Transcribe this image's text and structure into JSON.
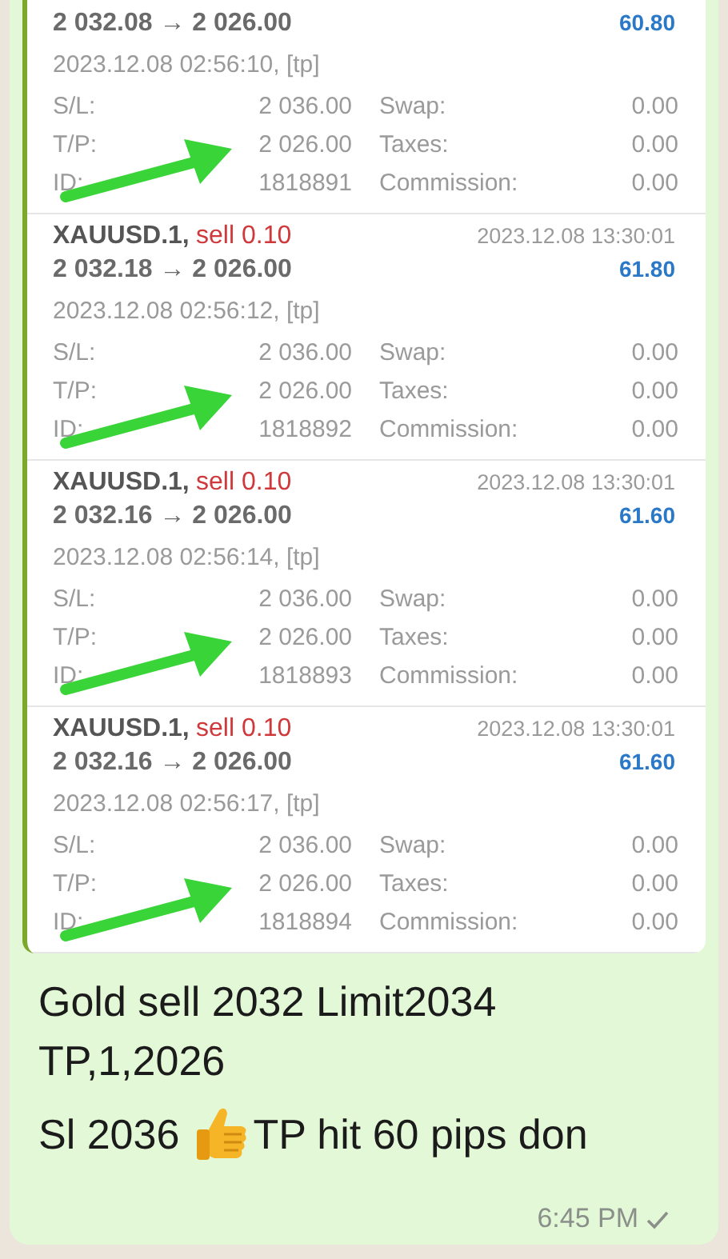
{
  "trades": [
    {
      "prices": "2 032.08 → 2 026.00",
      "profit": "60.80",
      "open_info": "2023.12.08 02:56:10, [tp]",
      "details": [
        {
          "label_1": "S/L:",
          "value_1": "2 036.00",
          "label_2": "Swap:",
          "value_2": "0.00"
        },
        {
          "label_1": "T/P:",
          "value_1": "2 026.00",
          "label_2": "Taxes:",
          "value_2": "0.00"
        },
        {
          "label_1": "ID:",
          "value_1": "1818891",
          "label_2": "Commission:",
          "value_2": "0.00"
        }
      ]
    },
    {
      "symbol": "XAUUSD.1,",
      "direction": "sell",
      "volume": "0.10",
      "close_time": "2023.12.08 13:30:01",
      "prices": "2 032.18 → 2 026.00",
      "profit": "61.80",
      "open_info": "2023.12.08 02:56:12, [tp]",
      "details": [
        {
          "label_1": "S/L:",
          "value_1": "2 036.00",
          "label_2": "Swap:",
          "value_2": "0.00"
        },
        {
          "label_1": "T/P:",
          "value_1": "2 026.00",
          "label_2": "Taxes:",
          "value_2": "0.00"
        },
        {
          "label_1": "ID:",
          "value_1": "1818892",
          "label_2": "Commission:",
          "value_2": "0.00"
        }
      ]
    },
    {
      "symbol": "XAUUSD.1,",
      "direction": "sell",
      "volume": "0.10",
      "close_time": "2023.12.08 13:30:01",
      "prices": "2 032.16 → 2 026.00",
      "profit": "61.60",
      "open_info": "2023.12.08 02:56:14, [tp]",
      "details": [
        {
          "label_1": "S/L:",
          "value_1": "2 036.00",
          "label_2": "Swap:",
          "value_2": "0.00"
        },
        {
          "label_1": "T/P:",
          "value_1": "2 026.00",
          "label_2": "Taxes:",
          "value_2": "0.00"
        },
        {
          "label_1": "ID:",
          "value_1": "1818893",
          "label_2": "Commission:",
          "value_2": "0.00"
        }
      ]
    },
    {
      "symbol": "XAUUSD.1,",
      "direction": "sell",
      "volume": "0.10",
      "close_time": "2023.12.08 13:30:01",
      "prices": "2 032.16 → 2 026.00",
      "profit": "61.60",
      "open_info": "2023.12.08 02:56:17, [tp]",
      "details": [
        {
          "label_1": "S/L:",
          "value_1": "2 036.00",
          "label_2": "Swap:",
          "value_2": "0.00"
        },
        {
          "label_1": "T/P:",
          "value_1": "2 026.00",
          "label_2": "Taxes:",
          "value_2": "0.00"
        },
        {
          "label_1": "ID:",
          "value_1": "1818894",
          "label_2": "Commission:",
          "value_2": "0.00"
        }
      ]
    }
  ],
  "message": {
    "lines": [
      "Gold sell 2032 Limit2034",
      "TP,1,2026"
    ],
    "last_line_before": "Sl 2036",
    "last_line_after": "TP hit 60 pips don"
  },
  "time": "6:45 PM",
  "delivered": false
}
